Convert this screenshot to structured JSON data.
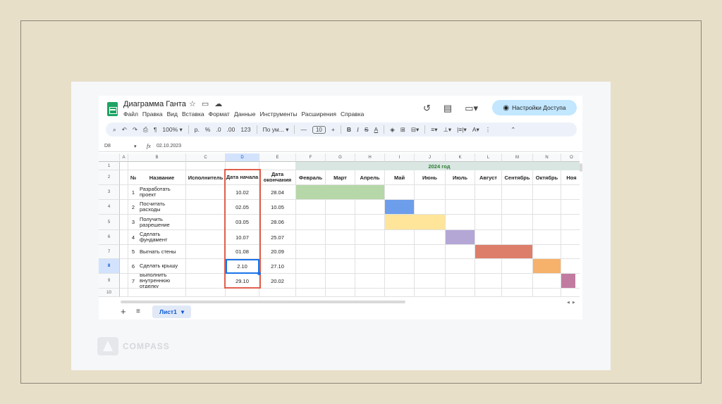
{
  "doc": {
    "title": "Диаграмма Ганта",
    "menu": [
      "Файл",
      "Правка",
      "Вид",
      "Вставка",
      "Формат",
      "Данные",
      "Инструменты",
      "Расширения",
      "Справка"
    ],
    "share_label": "Настройки Доступа"
  },
  "toolbar": {
    "zoom": "100%",
    "currency": "р.",
    "percent": "%",
    "dec_dec": ".0",
    "dec_inc": ".00",
    "num_format": "123",
    "font": "По ум...",
    "font_size": "10",
    "minus": "—",
    "plus": "+",
    "bold": "B",
    "italic": "I",
    "strike": "S",
    "textcolor": "A"
  },
  "formula_bar": {
    "cell_ref": "D8",
    "fx": "fx",
    "value": "02.10.2023"
  },
  "grid": {
    "columns": [
      "A",
      "B",
      "C",
      "D",
      "E",
      "F",
      "G",
      "H",
      "I",
      "J",
      "K",
      "L",
      "M",
      "N",
      "O"
    ],
    "rows": [
      "1",
      "2",
      "3",
      "4",
      "5",
      "6",
      "7",
      "8",
      "9",
      "10"
    ],
    "year_label": "2024 год",
    "headers": {
      "num": "№",
      "name": "Название",
      "executor": "Исполнитель",
      "start": "Дата начала",
      "end": "Дата окончания",
      "months": [
        "Февраль",
        "Март",
        "Апрель",
        "Май",
        "Июнь",
        "Июль",
        "Август",
        "Сентябрь",
        "Октябрь",
        "Ноя"
      ]
    },
    "tasks": [
      {
        "num": "1",
        "name": "Разработать проект",
        "start": "10.02",
        "end": "28.04"
      },
      {
        "num": "2",
        "name": "Посчитать расходы",
        "start": "02.05",
        "end": "10.05"
      },
      {
        "num": "3",
        "name": "Получить разрешение",
        "start": "03.05",
        "end": "28.06"
      },
      {
        "num": "4",
        "name": "Сделать фундамент",
        "start": "10.07",
        "end": "25.07"
      },
      {
        "num": "5",
        "name": "Выгнать стены",
        "start": "01.08",
        "end": "20.09"
      },
      {
        "num": "6",
        "name": "Сделать крышу",
        "start": "2.10",
        "end": "27.10"
      },
      {
        "num": "7",
        "name": "Выполнить внутреннюю отделку",
        "start": "29.10",
        "end": "20.02"
      }
    ],
    "bar_colors": [
      "#b6d7a8",
      "#6d9eeb",
      "#ffe599",
      "#b4a7d6",
      "#dd7e6b",
      "#f6b26b",
      "#c27ba0"
    ],
    "selected_cell": "D8"
  },
  "sheet_tabs": {
    "add": "+",
    "list": "≡",
    "active": "Лист1",
    "dropdown": "▾"
  },
  "watermark": "COMPASS"
}
